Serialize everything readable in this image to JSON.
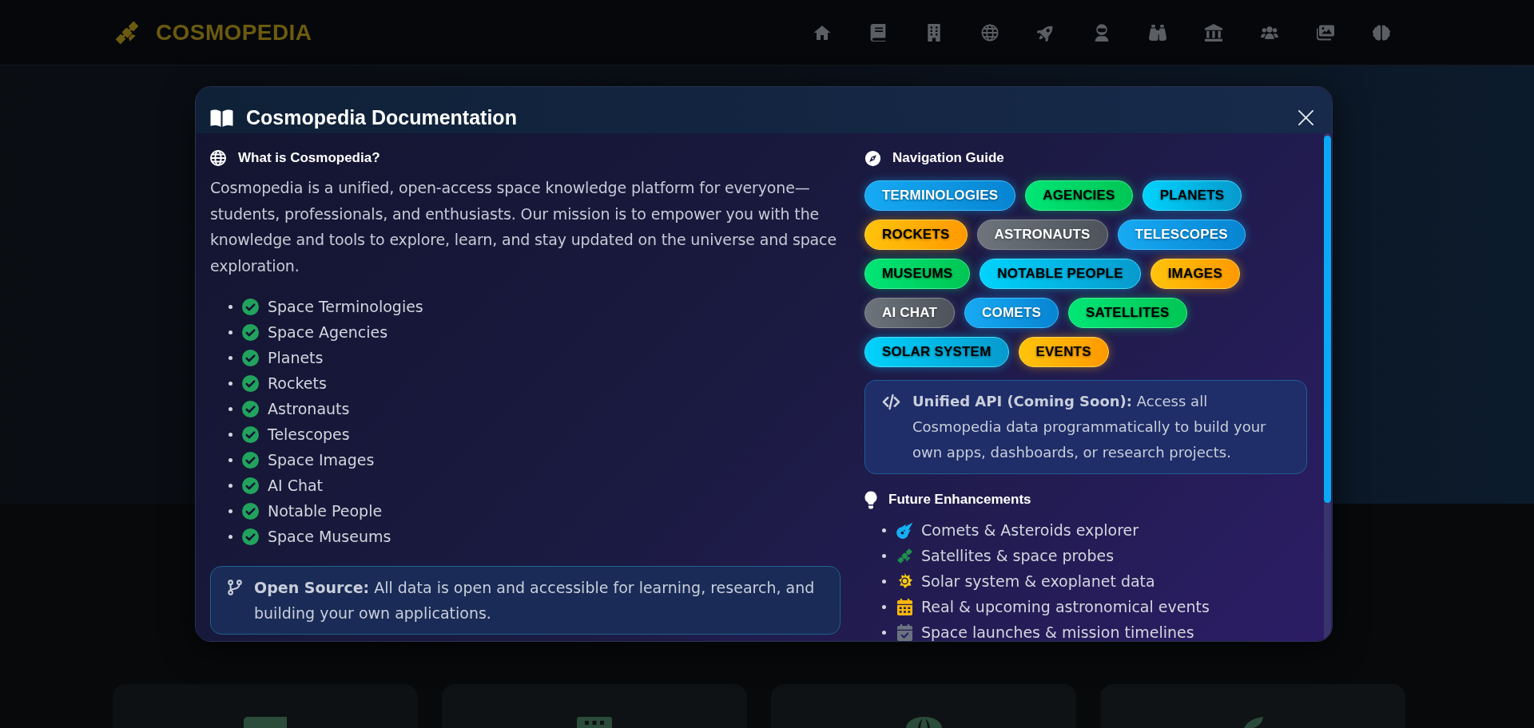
{
  "header": {
    "logo": "COSMOPEDIA"
  },
  "modal": {
    "title": "Cosmopedia Documentation",
    "about": {
      "heading": "What is Cosmopedia?",
      "text": "Cosmopedia is a unified, open-access space knowledge platform for everyone—students, professionals, and enthusiasts. Our mission is to empower you with the knowledge and tools to explore, learn, and stay updated on the universe and space exploration.",
      "features": [
        "Space Terminologies",
        "Space Agencies",
        "Planets",
        "Rockets",
        "Astronauts",
        "Telescopes",
        "Space Images",
        "AI Chat",
        "Notable People",
        "Space Museums"
      ],
      "note": "**Open Source:** All data is open and accessible for learning, research, and building your own applications."
    },
    "navigation": {
      "heading": "Navigation Guide",
      "links": [
        {
          "label": "TERMINOLOGIES",
          "kind": "primary"
        },
        {
          "label": "AGENCIES",
          "kind": "success"
        },
        {
          "label": "PLANETS",
          "kind": "info"
        },
        {
          "label": "ROCKETS",
          "kind": "warning"
        },
        {
          "label": "ASTRONAUTS",
          "kind": "secondary"
        },
        {
          "label": "TELESCOPES",
          "kind": "primary"
        },
        {
          "label": "MUSEUMS",
          "kind": "success"
        },
        {
          "label": "NOTABLE PEOPLE",
          "kind": "info"
        },
        {
          "label": "IMAGES",
          "kind": "warning"
        },
        {
          "label": "AI CHAT",
          "kind": "secondary"
        },
        {
          "label": "COMETS",
          "kind": "primary"
        },
        {
          "label": "SATELLITES",
          "kind": "success"
        },
        {
          "label": "SOLAR SYSTEM",
          "kind": "info"
        },
        {
          "label": "EVENTS",
          "kind": "warning"
        }
      ]
    },
    "api_note": "**Unified API (Coming Soon):** Access all Cosmopedia data programmatically to build your own apps, dashboards, or research projects.",
    "future": {
      "heading": "Future Enhancements",
      "items": [
        "Comets & Asteroids explorer",
        "Satellites & space probes",
        "Solar system & exoplanet data",
        "Real & upcoming astronomical events",
        "Space launches & mission timelines"
      ]
    }
  }
}
